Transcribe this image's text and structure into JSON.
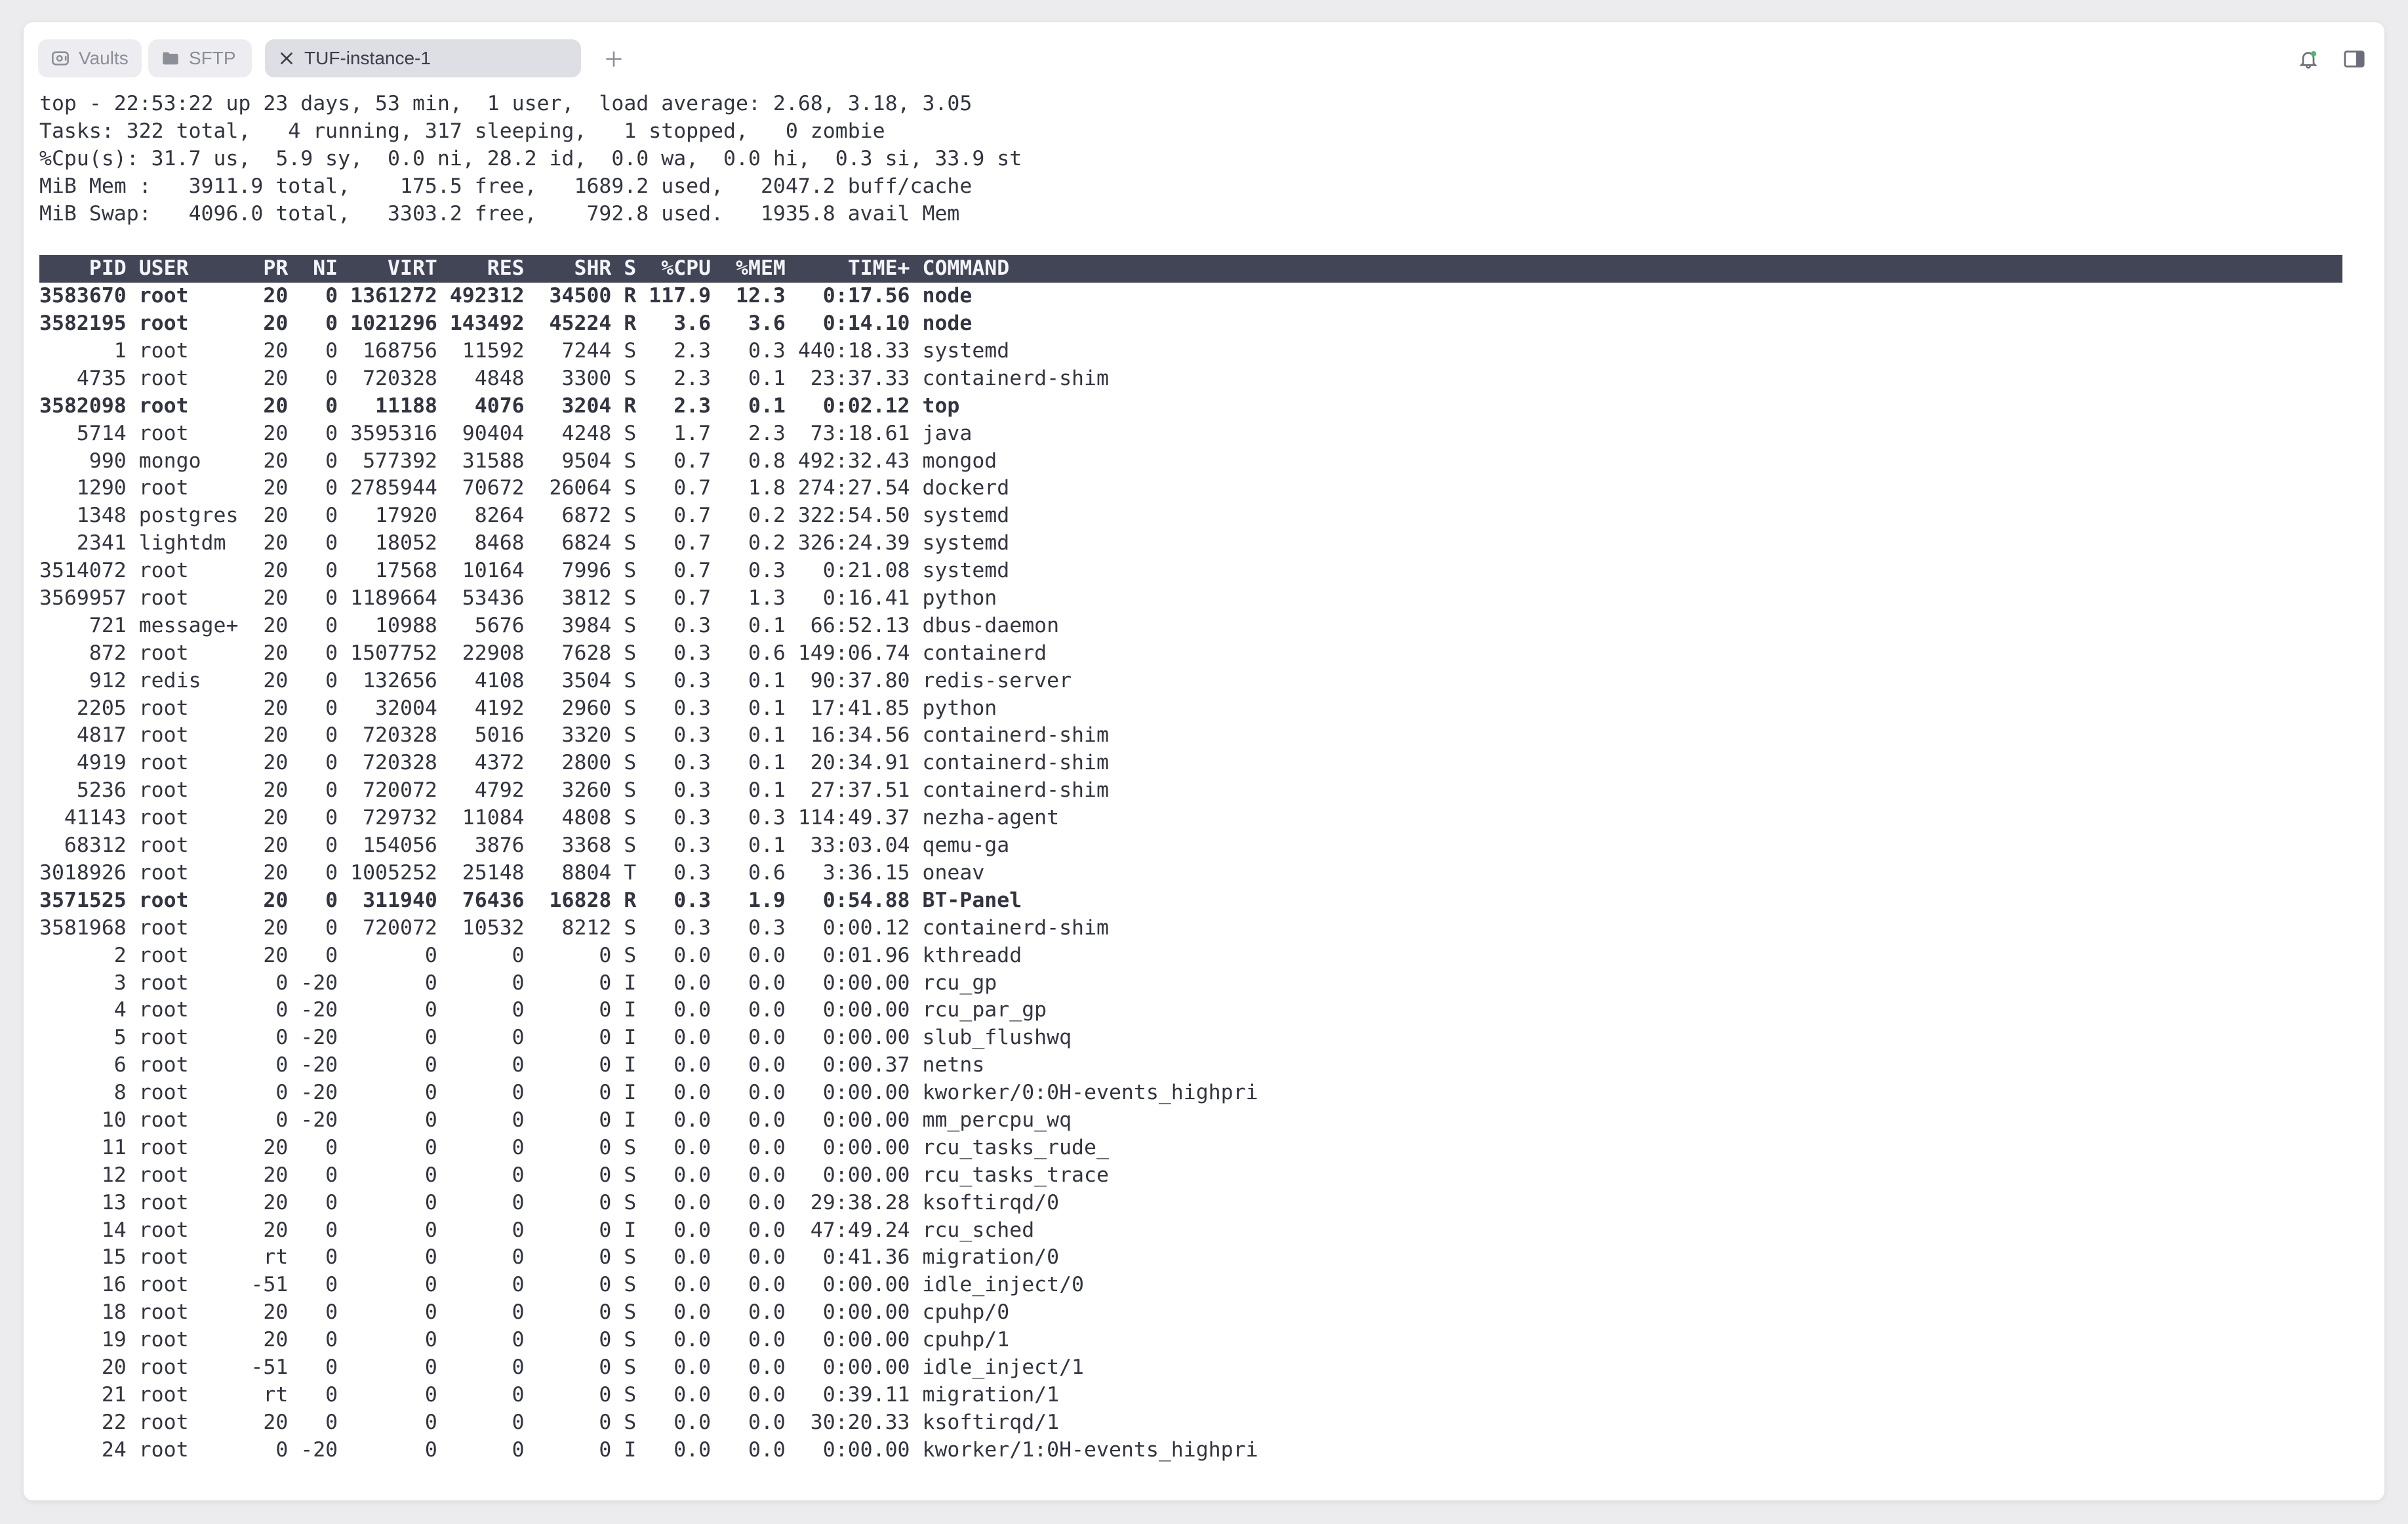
{
  "tabs": [
    {
      "label": "Vaults",
      "icon": "vault-icon"
    },
    {
      "label": "SFTP",
      "icon": "folder-icon"
    },
    {
      "label": "TUF-instance-1",
      "icon": "close-icon",
      "active": true
    }
  ],
  "colors": {
    "header_bar": "#414556",
    "text": "#323541",
    "tab_active": "#dedfe4"
  },
  "terminal": {
    "summary": [
      "top - 22:53:22 up 23 days, 53 min,  1 user,  load average: 2.68, 3.18, 3.05",
      "Tasks: 322 total,   4 running, 317 sleeping,   1 stopped,   0 zombie",
      "%Cpu(s): 31.7 us,  5.9 sy,  0.0 ni, 28.2 id,  0.0 wa,  0.0 hi,  0.3 si, 33.9 st",
      "MiB Mem :   3911.9 total,    175.5 free,   1689.2 used,   2047.2 buff/cache",
      "MiB Swap:   4096.0 total,   3303.2 free,    792.8 used.   1935.8 avail Mem"
    ],
    "header": "    PID USER      PR  NI    VIRT    RES    SHR S  %CPU  %MEM     TIME+ COMMAND",
    "processes": [
      {
        "text": "3583670 root      20   0 1361272 492312  34500 R 117.9  12.3   0:17.56 node",
        "bold": true
      },
      {
        "text": "3582195 root      20   0 1021296 143492  45224 R   3.6   3.6   0:14.10 node",
        "bold": true
      },
      {
        "text": "      1 root      20   0  168756  11592   7244 S   2.3   0.3 440:18.33 systemd",
        "bold": false
      },
      {
        "text": "   4735 root      20   0  720328   4848   3300 S   2.3   0.1  23:37.33 containerd-shim",
        "bold": false
      },
      {
        "text": "3582098 root      20   0   11188   4076   3204 R   2.3   0.1   0:02.12 top",
        "bold": true
      },
      {
        "text": "   5714 root      20   0 3595316  90404   4248 S   1.7   2.3  73:18.61 java",
        "bold": false
      },
      {
        "text": "    990 mongo     20   0  577392  31588   9504 S   0.7   0.8 492:32.43 mongod",
        "bold": false
      },
      {
        "text": "   1290 root      20   0 2785944  70672  26064 S   0.7   1.8 274:27.54 dockerd",
        "bold": false
      },
      {
        "text": "   1348 postgres  20   0   17920   8264   6872 S   0.7   0.2 322:54.50 systemd",
        "bold": false
      },
      {
        "text": "   2341 lightdm   20   0   18052   8468   6824 S   0.7   0.2 326:24.39 systemd",
        "bold": false
      },
      {
        "text": "3514072 root      20   0   17568  10164   7996 S   0.7   0.3   0:21.08 systemd",
        "bold": false
      },
      {
        "text": "3569957 root      20   0 1189664  53436   3812 S   0.7   1.3   0:16.41 python",
        "bold": false
      },
      {
        "text": "    721 message+  20   0   10988   5676   3984 S   0.3   0.1  66:52.13 dbus-daemon",
        "bold": false
      },
      {
        "text": "    872 root      20   0 1507752  22908   7628 S   0.3   0.6 149:06.74 containerd",
        "bold": false
      },
      {
        "text": "    912 redis     20   0  132656   4108   3504 S   0.3   0.1  90:37.80 redis-server",
        "bold": false
      },
      {
        "text": "   2205 root      20   0   32004   4192   2960 S   0.3   0.1  17:41.85 python",
        "bold": false
      },
      {
        "text": "   4817 root      20   0  720328   5016   3320 S   0.3   0.1  16:34.56 containerd-shim",
        "bold": false
      },
      {
        "text": "   4919 root      20   0  720328   4372   2800 S   0.3   0.1  20:34.91 containerd-shim",
        "bold": false
      },
      {
        "text": "   5236 root      20   0  720072   4792   3260 S   0.3   0.1  27:37.51 containerd-shim",
        "bold": false
      },
      {
        "text": "  41143 root      20   0  729732  11084   4808 S   0.3   0.3 114:49.37 nezha-agent",
        "bold": false
      },
      {
        "text": "  68312 root      20   0  154056   3876   3368 S   0.3   0.1  33:03.04 qemu-ga",
        "bold": false
      },
      {
        "text": "3018926 root      20   0 1005252  25148   8804 T   0.3   0.6   3:36.15 oneav",
        "bold": false
      },
      {
        "text": "3571525 root      20   0  311940  76436  16828 R   0.3   1.9   0:54.88 BT-Panel",
        "bold": true
      },
      {
        "text": "3581968 root      20   0  720072  10532   8212 S   0.3   0.3   0:00.12 containerd-shim",
        "bold": false
      },
      {
        "text": "      2 root      20   0       0      0      0 S   0.0   0.0   0:01.96 kthreadd",
        "bold": false
      },
      {
        "text": "      3 root       0 -20       0      0      0 I   0.0   0.0   0:00.00 rcu_gp",
        "bold": false
      },
      {
        "text": "      4 root       0 -20       0      0      0 I   0.0   0.0   0:00.00 rcu_par_gp",
        "bold": false
      },
      {
        "text": "      5 root       0 -20       0      0      0 I   0.0   0.0   0:00.00 slub_flushwq",
        "bold": false
      },
      {
        "text": "      6 root       0 -20       0      0      0 I   0.0   0.0   0:00.37 netns",
        "bold": false
      },
      {
        "text": "      8 root       0 -20       0      0      0 I   0.0   0.0   0:00.00 kworker/0:0H-events_highpri",
        "bold": false
      },
      {
        "text": "     10 root       0 -20       0      0      0 I   0.0   0.0   0:00.00 mm_percpu_wq",
        "bold": false
      },
      {
        "text": "     11 root      20   0       0      0      0 S   0.0   0.0   0:00.00 rcu_tasks_rude_",
        "bold": false
      },
      {
        "text": "     12 root      20   0       0      0      0 S   0.0   0.0   0:00.00 rcu_tasks_trace",
        "bold": false
      },
      {
        "text": "     13 root      20   0       0      0      0 S   0.0   0.0  29:38.28 ksoftirqd/0",
        "bold": false
      },
      {
        "text": "     14 root      20   0       0      0      0 I   0.0   0.0  47:49.24 rcu_sched",
        "bold": false
      },
      {
        "text": "     15 root      rt   0       0      0      0 S   0.0   0.0   0:41.36 migration/0",
        "bold": false
      },
      {
        "text": "     16 root     -51   0       0      0      0 S   0.0   0.0   0:00.00 idle_inject/0",
        "bold": false
      },
      {
        "text": "     18 root      20   0       0      0      0 S   0.0   0.0   0:00.00 cpuhp/0",
        "bold": false
      },
      {
        "text": "     19 root      20   0       0      0      0 S   0.0   0.0   0:00.00 cpuhp/1",
        "bold": false
      },
      {
        "text": "     20 root     -51   0       0      0      0 S   0.0   0.0   0:00.00 idle_inject/1",
        "bold": false
      },
      {
        "text": "     21 root      rt   0       0      0      0 S   0.0   0.0   0:39.11 migration/1",
        "bold": false
      },
      {
        "text": "     22 root      20   0       0      0      0 S   0.0   0.0  30:20.33 ksoftirqd/1",
        "bold": false
      },
      {
        "text": "     24 root       0 -20       0      0      0 I   0.0   0.0   0:00.00 kworker/1:0H-events_highpri",
        "bold": false
      }
    ]
  }
}
